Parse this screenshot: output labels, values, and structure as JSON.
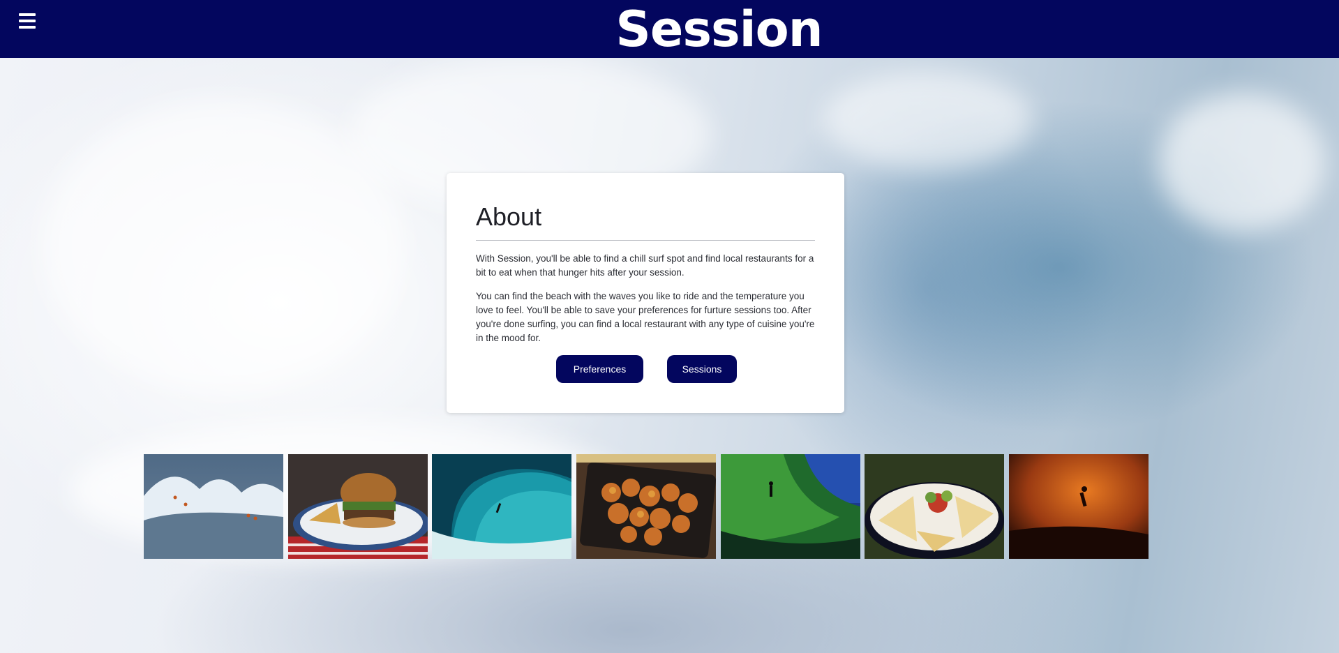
{
  "header": {
    "brand": "Session",
    "menu_icon": "hamburger-menu-icon",
    "background_color": "#03065e"
  },
  "about": {
    "title": "About",
    "paragraphs": [
      "With Session, you'll be able to find a chill surf spot and find local restaurants for a bit to eat when that hunger hits after your session.",
      "You can find the beach with the waves you like to ride and the temperature you love to feel. You'll be able to save your preferences for furture sessions too. After you're done surfing, you can find a local restaurant with any type of cuisine you're in the mood for."
    ],
    "buttons": {
      "preferences": "Preferences",
      "sessions": "Sessions"
    },
    "button_color": "#03065e"
  },
  "gallery": {
    "images": [
      {
        "subject": "surfers-on-big-wave"
      },
      {
        "subject": "burger-and-fries"
      },
      {
        "subject": "surfer-in-barrel-wave"
      },
      {
        "subject": "orange-chicken-plate"
      },
      {
        "subject": "surfer-green-wave"
      },
      {
        "subject": "quesadilla-plate"
      },
      {
        "subject": "surfer-silhouette-sunset"
      }
    ]
  }
}
